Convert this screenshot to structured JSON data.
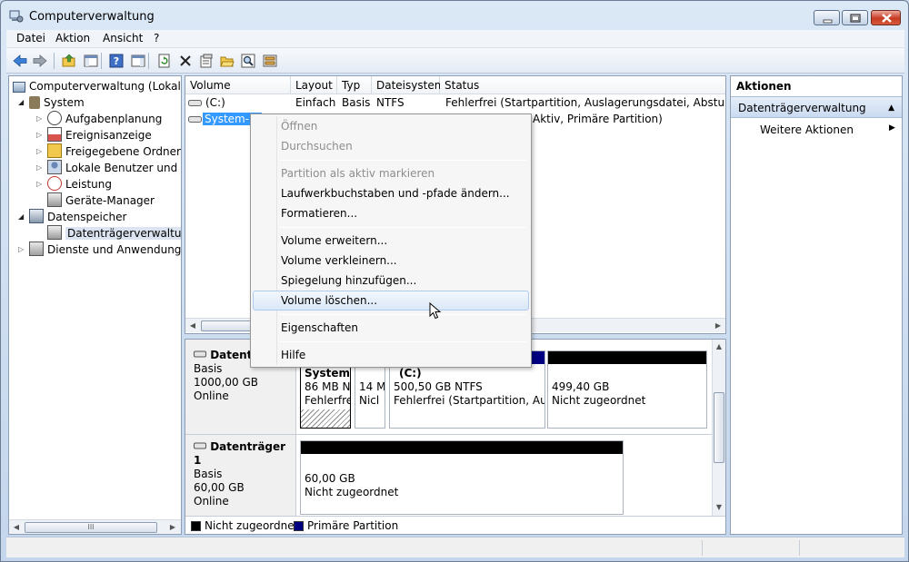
{
  "window": {
    "title": "Computerverwaltung"
  },
  "menubar": [
    "Datei",
    "Aktion",
    "Ansicht",
    "?"
  ],
  "tree": {
    "root": "Computerverwaltung (Lokal)",
    "system": "System",
    "system_items": [
      "Aufgabenplanung",
      "Ereignisanzeige",
      "Freigegebene Ordner",
      "Lokale Benutzer und Gr",
      "Leistung",
      "Geräte-Manager"
    ],
    "storage": "Datenspeicher",
    "storage_items": [
      "Datenträgerverwaltung"
    ],
    "services": "Dienste und Anwendungen",
    "scroll_grip": "III"
  },
  "volume_table": {
    "columns": [
      "Volume",
      "Layout",
      "Typ",
      "Dateisystem",
      "Status"
    ],
    "rows": [
      {
        "volume": "(C:)",
        "layout": "Einfach",
        "type": "Basis",
        "fs": "NTFS",
        "status": "Fehlerfrei (Startpartition, Auslagerungsdatei, Absturzabbild"
      },
      {
        "volume": "System-re",
        "layout": "",
        "type": "",
        "fs": "",
        "status": "Aktiv, Primäre Partition)"
      }
    ]
  },
  "disks": [
    {
      "title": "Datenträ",
      "type": "Basis",
      "size": "1000,00 GB",
      "state": "Online",
      "partitions": [
        {
          "name": "System-",
          "size": "86 MB N",
          "status": "Fehlerfre"
        },
        {
          "name": "",
          "size": "14 M",
          "status": "Nicl"
        },
        {
          "name": "(C:)",
          "size": "500,50 GB NTFS",
          "status": "Fehlerfrei (Startpartition, Ausla"
        },
        {
          "name": "",
          "size": "499,40 GB",
          "status": "Nicht zugeordnet"
        }
      ]
    },
    {
      "title": "Datenträger 1",
      "type": "Basis",
      "size": "60,00 GB",
      "state": "Online",
      "partitions": [
        {
          "name": "",
          "size": "60,00 GB",
          "status": "Nicht zugeordnet"
        }
      ]
    }
  ],
  "legend": {
    "unallocated": "Nicht zugeordnet",
    "primary": "Primäre Partition"
  },
  "actions_pane": {
    "title": "Aktionen",
    "section": "Datenträgerverwaltung",
    "more": "Weitere Aktionen"
  },
  "context_menu": {
    "items": [
      {
        "label": "Öffnen",
        "enabled": false
      },
      {
        "label": "Durchsuchen",
        "enabled": false
      },
      {
        "label": "Partition als aktiv markieren",
        "enabled": false
      },
      {
        "label": "Laufwerkbuchstaben und -pfade ändern...",
        "enabled": true
      },
      {
        "label": "Formatieren...",
        "enabled": true
      },
      {
        "label": "Volume erweitern...",
        "enabled": true
      },
      {
        "label": "Volume verkleinern...",
        "enabled": true
      },
      {
        "label": "Spiegelung hinzufügen...",
        "enabled": true
      },
      {
        "label": "Volume löschen...",
        "enabled": true,
        "highlighted": true
      },
      {
        "label": "Eigenschaften",
        "enabled": true
      },
      {
        "label": "Hilfe",
        "enabled": true
      }
    ]
  },
  "colors": {
    "primary_partition": "#000080",
    "unallocated": "#000000",
    "selection": "#3399ff"
  }
}
